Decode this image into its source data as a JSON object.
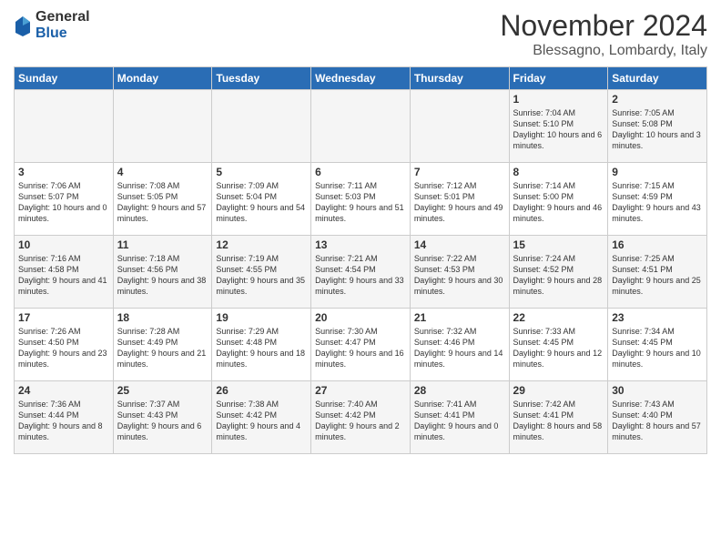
{
  "header": {
    "logo_general": "General",
    "logo_blue": "Blue",
    "title": "November 2024",
    "location": "Blessagno, Lombardy, Italy"
  },
  "weekdays": [
    "Sunday",
    "Monday",
    "Tuesday",
    "Wednesday",
    "Thursday",
    "Friday",
    "Saturday"
  ],
  "weeks": [
    [
      {
        "day": "",
        "info": ""
      },
      {
        "day": "",
        "info": ""
      },
      {
        "day": "",
        "info": ""
      },
      {
        "day": "",
        "info": ""
      },
      {
        "day": "",
        "info": ""
      },
      {
        "day": "1",
        "info": "Sunrise: 7:04 AM\nSunset: 5:10 PM\nDaylight: 10 hours\nand 6 minutes."
      },
      {
        "day": "2",
        "info": "Sunrise: 7:05 AM\nSunset: 5:08 PM\nDaylight: 10 hours\nand 3 minutes."
      }
    ],
    [
      {
        "day": "3",
        "info": "Sunrise: 7:06 AM\nSunset: 5:07 PM\nDaylight: 10 hours\nand 0 minutes."
      },
      {
        "day": "4",
        "info": "Sunrise: 7:08 AM\nSunset: 5:05 PM\nDaylight: 9 hours\nand 57 minutes."
      },
      {
        "day": "5",
        "info": "Sunrise: 7:09 AM\nSunset: 5:04 PM\nDaylight: 9 hours\nand 54 minutes."
      },
      {
        "day": "6",
        "info": "Sunrise: 7:11 AM\nSunset: 5:03 PM\nDaylight: 9 hours\nand 51 minutes."
      },
      {
        "day": "7",
        "info": "Sunrise: 7:12 AM\nSunset: 5:01 PM\nDaylight: 9 hours\nand 49 minutes."
      },
      {
        "day": "8",
        "info": "Sunrise: 7:14 AM\nSunset: 5:00 PM\nDaylight: 9 hours\nand 46 minutes."
      },
      {
        "day": "9",
        "info": "Sunrise: 7:15 AM\nSunset: 4:59 PM\nDaylight: 9 hours\nand 43 minutes."
      }
    ],
    [
      {
        "day": "10",
        "info": "Sunrise: 7:16 AM\nSunset: 4:58 PM\nDaylight: 9 hours\nand 41 minutes."
      },
      {
        "day": "11",
        "info": "Sunrise: 7:18 AM\nSunset: 4:56 PM\nDaylight: 9 hours\nand 38 minutes."
      },
      {
        "day": "12",
        "info": "Sunrise: 7:19 AM\nSunset: 4:55 PM\nDaylight: 9 hours\nand 35 minutes."
      },
      {
        "day": "13",
        "info": "Sunrise: 7:21 AM\nSunset: 4:54 PM\nDaylight: 9 hours\nand 33 minutes."
      },
      {
        "day": "14",
        "info": "Sunrise: 7:22 AM\nSunset: 4:53 PM\nDaylight: 9 hours\nand 30 minutes."
      },
      {
        "day": "15",
        "info": "Sunrise: 7:24 AM\nSunset: 4:52 PM\nDaylight: 9 hours\nand 28 minutes."
      },
      {
        "day": "16",
        "info": "Sunrise: 7:25 AM\nSunset: 4:51 PM\nDaylight: 9 hours\nand 25 minutes."
      }
    ],
    [
      {
        "day": "17",
        "info": "Sunrise: 7:26 AM\nSunset: 4:50 PM\nDaylight: 9 hours\nand 23 minutes."
      },
      {
        "day": "18",
        "info": "Sunrise: 7:28 AM\nSunset: 4:49 PM\nDaylight: 9 hours\nand 21 minutes."
      },
      {
        "day": "19",
        "info": "Sunrise: 7:29 AM\nSunset: 4:48 PM\nDaylight: 9 hours\nand 18 minutes."
      },
      {
        "day": "20",
        "info": "Sunrise: 7:30 AM\nSunset: 4:47 PM\nDaylight: 9 hours\nand 16 minutes."
      },
      {
        "day": "21",
        "info": "Sunrise: 7:32 AM\nSunset: 4:46 PM\nDaylight: 9 hours\nand 14 minutes."
      },
      {
        "day": "22",
        "info": "Sunrise: 7:33 AM\nSunset: 4:45 PM\nDaylight: 9 hours\nand 12 minutes."
      },
      {
        "day": "23",
        "info": "Sunrise: 7:34 AM\nSunset: 4:45 PM\nDaylight: 9 hours\nand 10 minutes."
      }
    ],
    [
      {
        "day": "24",
        "info": "Sunrise: 7:36 AM\nSunset: 4:44 PM\nDaylight: 9 hours\nand 8 minutes."
      },
      {
        "day": "25",
        "info": "Sunrise: 7:37 AM\nSunset: 4:43 PM\nDaylight: 9 hours\nand 6 minutes."
      },
      {
        "day": "26",
        "info": "Sunrise: 7:38 AM\nSunset: 4:42 PM\nDaylight: 9 hours\nand 4 minutes."
      },
      {
        "day": "27",
        "info": "Sunrise: 7:40 AM\nSunset: 4:42 PM\nDaylight: 9 hours\nand 2 minutes."
      },
      {
        "day": "28",
        "info": "Sunrise: 7:41 AM\nSunset: 4:41 PM\nDaylight: 9 hours\nand 0 minutes."
      },
      {
        "day": "29",
        "info": "Sunrise: 7:42 AM\nSunset: 4:41 PM\nDaylight: 8 hours\nand 58 minutes."
      },
      {
        "day": "30",
        "info": "Sunrise: 7:43 AM\nSunset: 4:40 PM\nDaylight: 8 hours\nand 57 minutes."
      }
    ]
  ]
}
